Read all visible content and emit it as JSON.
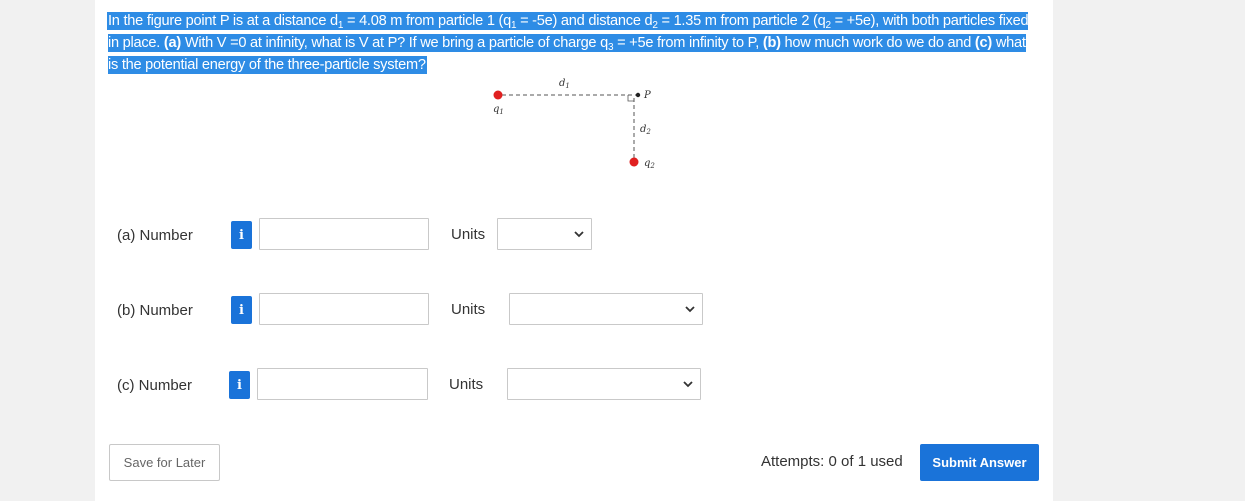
{
  "question": {
    "segments": [
      {
        "text": "In the figure point P is at a distance d",
        "sub": false,
        "bold": false
      },
      {
        "text": "1",
        "sub": true,
        "bold": false
      },
      {
        "text": " = 4.08 m from particle 1 (q",
        "sub": false,
        "bold": false
      },
      {
        "text": "1",
        "sub": true,
        "bold": false
      },
      {
        "text": " = -5e) and distance d",
        "sub": false,
        "bold": false
      },
      {
        "text": "2",
        "sub": true,
        "bold": false
      },
      {
        "text": " = 1.35 m from particle 2 (q",
        "sub": false,
        "bold": false
      },
      {
        "text": "2",
        "sub": true,
        "bold": false
      },
      {
        "text": " = +5e), with both particles fixed in place. ",
        "sub": false,
        "bold": false
      },
      {
        "text": "(a)",
        "sub": false,
        "bold": true
      },
      {
        "text": " With V =0 at infinity, what is V at P? If we bring a particle of charge q",
        "sub": false,
        "bold": false
      },
      {
        "text": "3",
        "sub": true,
        "bold": false
      },
      {
        "text": " = +5e from infinity to P, ",
        "sub": false,
        "bold": false
      },
      {
        "text": "(b)",
        "sub": false,
        "bold": true
      },
      {
        "text": " how much work do we do and ",
        "sub": false,
        "bold": false
      },
      {
        "text": "(c)",
        "sub": false,
        "bold": true
      },
      {
        "text": " what is the potential energy of the three-particle system?",
        "sub": false,
        "bold": false
      }
    ]
  },
  "figure": {
    "d1_label": "d",
    "d1_sub": "1",
    "p_label": "P",
    "q1_label": "q",
    "q1_sub": "1",
    "d2_label": "d",
    "d2_sub": "2",
    "q2_label": "q",
    "q2_sub": "2",
    "charge_color": "#e02020"
  },
  "parts": [
    {
      "label": "(a)  Number",
      "input_value": "",
      "units_label": "Units",
      "units_value": ""
    },
    {
      "label": "(b)  Number",
      "input_value": "",
      "units_label": "Units",
      "units_value": ""
    },
    {
      "label": "(c)  Number",
      "input_value": "",
      "units_label": "Units",
      "units_value": ""
    }
  ],
  "info_icon": "i",
  "footer": {
    "save_label": "Save for Later",
    "attempts_text": "Attempts: 0 of 1 used",
    "submit_label": "Submit Answer"
  },
  "colors": {
    "accent": "#1a73d9",
    "highlight": "#2e8ce5"
  }
}
